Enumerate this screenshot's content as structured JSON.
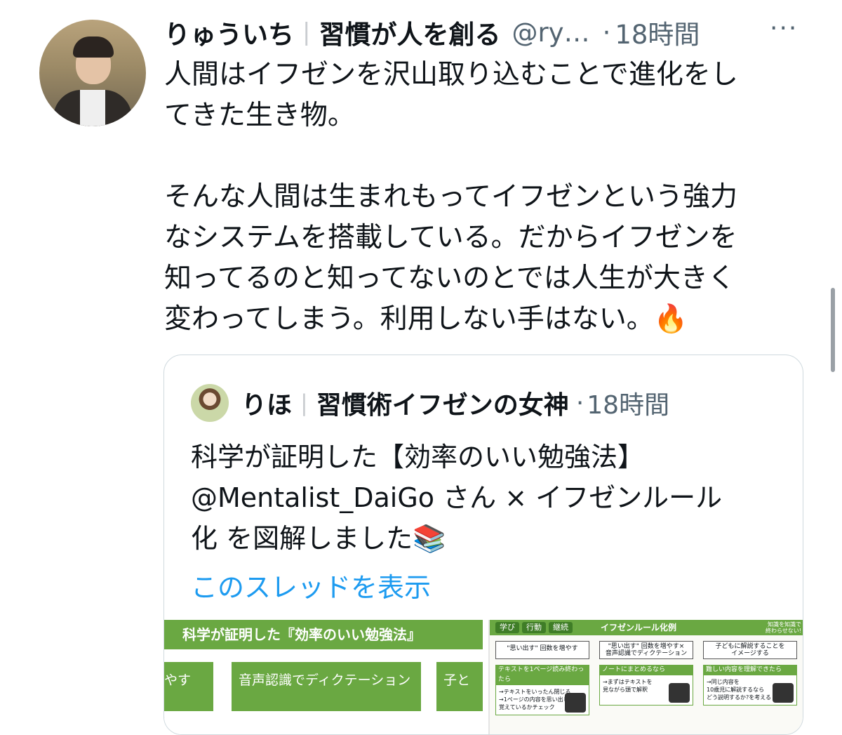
{
  "tweet": {
    "display_name": "りゅういち",
    "separator": "|",
    "bio_name": "習慣が人を創る",
    "handle": "@ry…",
    "dot": "·",
    "time": "18時間",
    "more": "···",
    "text": "人間はイフゼンを沢山取り込むことで進化をし\nてきた生き物。\n\nそんな人間は生まれもってイフゼンという強力\nなシステムを搭載している。だからイフゼンを\n知ってるのと知ってないのとでは人生が大きく\n変わってしまう。利用しない手はない。🔥"
  },
  "quote": {
    "display_name": "りほ",
    "separator": "|",
    "bio_name": "習慣術イフゼンの女神",
    "dot": "·",
    "time": "18時間",
    "text": "科学が証明した【効率のいい勉強法】\n@Mentalist_DaiGo さん × イフゼンルール\n化 を図解しました📚",
    "thread_link": "このスレッドを表示"
  },
  "media_left": {
    "banner": "科学が証明した『効率のいい勉強法』",
    "box1": "やす",
    "box2": "音声認識でディクテーション",
    "box3": "子と"
  },
  "media_right": {
    "tab1": "学び",
    "tab2": "行動",
    "tab3": "継続",
    "title": "イフゼンルール化例",
    "corner": "知識を知識で\n終わらせない!",
    "col1_head": "\"思い出す\" 回数を増やす",
    "col1_sub": "テキストを1ページ読み終わったら",
    "col1_body": "→テキストをいったん閉じる\n→1ページの内容を思い出して、\n覚えているかチェック",
    "col2_head": "\"思い出す\" 回数を増やす×\n音声認識でディクテーション",
    "col2_sub": "ノートにまとめるなら",
    "col2_body": "→まずはテキストを\n見ながら頭で解釈",
    "col3_head": "子どもに解説することを\nイメージする",
    "col3_sub": "難しい内容を理解できたら",
    "col3_body": "→同じ内容を\n10歳児に解説するなら\nどう説明するか?を考える"
  },
  "colors": {
    "accent_link": "#1d9bf0",
    "muted": "#536471",
    "green": "#6aa842"
  }
}
